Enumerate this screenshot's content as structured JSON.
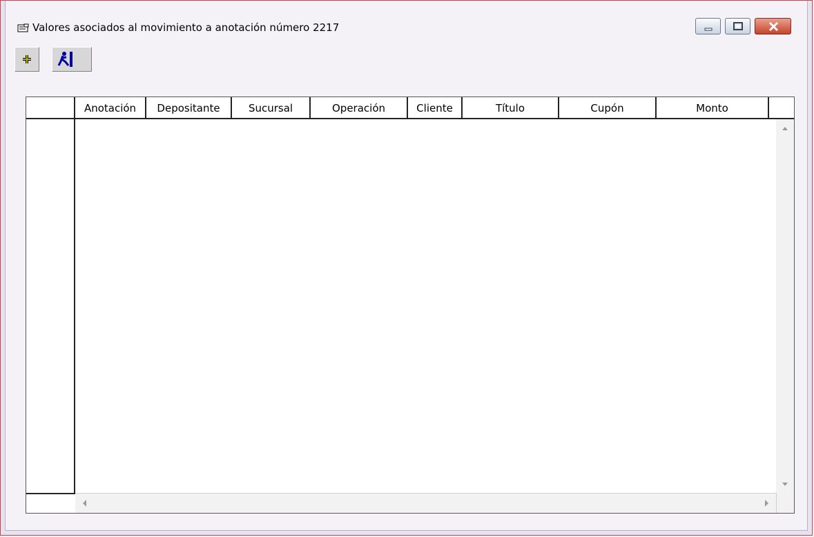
{
  "window": {
    "title": "Valores asociados al movimiento a anotación número 2217",
    "controls": {
      "minimize": "minimize-icon",
      "maximize": "maximize-icon",
      "close": "close-icon"
    }
  },
  "toolbar": {
    "buttons": [
      {
        "icon": "add-icon"
      },
      {
        "icon": "exit-icon"
      }
    ]
  },
  "grid": {
    "columns": [
      "",
      "Anotación",
      "Depositante",
      "Sucursal",
      "Operación",
      "Cliente",
      "Título",
      "Cupón",
      "Monto"
    ],
    "rows": []
  },
  "colors": {
    "titlebar_border": "#c9414a",
    "close_button": "#c5452d",
    "add_icon": "#b9b000",
    "exit_icon": "#0000a0"
  }
}
